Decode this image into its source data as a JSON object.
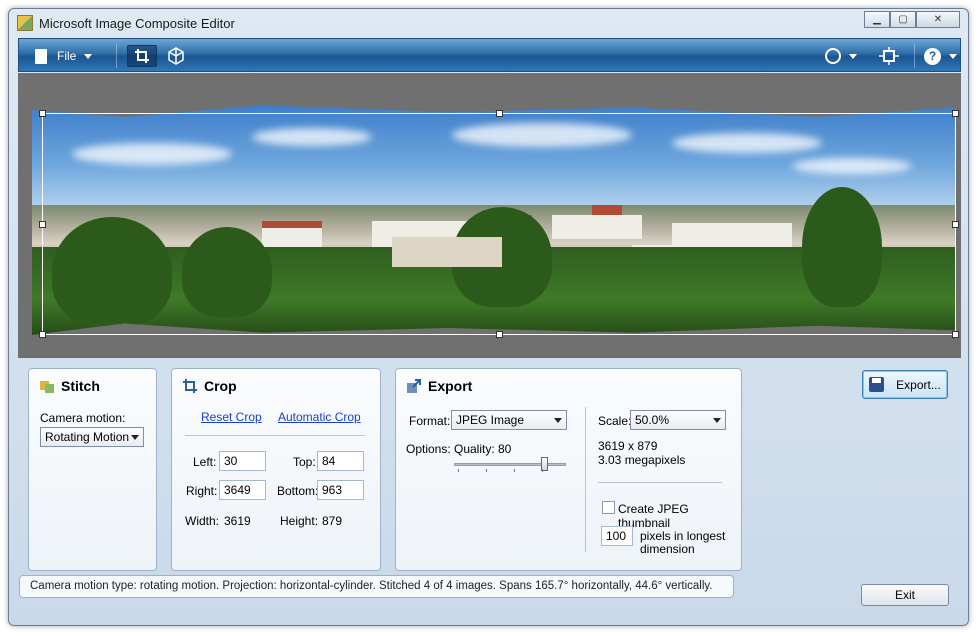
{
  "window": {
    "title": "Microsoft Image Composite Editor"
  },
  "toolbar": {
    "file_label": "File"
  },
  "stitch": {
    "title": "Stitch",
    "camera_motion_label": "Camera motion:",
    "camera_motion_value": "Rotating Motion"
  },
  "crop": {
    "title": "Crop",
    "reset_link": "Reset Crop",
    "auto_link": "Automatic Crop",
    "left_label": "Left:",
    "left_value": "30",
    "top_label": "Top:",
    "top_value": "84",
    "right_label": "Right:",
    "right_value": "3649",
    "bottom_label": "Bottom:",
    "bottom_value": "963",
    "width_label": "Width:",
    "width_value": "3619",
    "height_label": "Height:",
    "height_value": "879"
  },
  "export": {
    "title": "Export",
    "format_label": "Format:",
    "format_value": "JPEG Image",
    "options_label": "Options:",
    "quality_label": "Quality:",
    "quality_value": "80",
    "quality_fraction": 0.8,
    "scale_label": "Scale:",
    "scale_value": "50.0%",
    "dimensions": "3619 x 879",
    "megapixels": "3.03 megapixels",
    "thumbnail_label": "Create JPEG thumbnail",
    "thumbnail_checked": false,
    "pixels_value": "100",
    "pixels_label_1": "pixels in longest",
    "pixels_label_2": "dimension"
  },
  "buttons": {
    "export": "Export...",
    "exit": "Exit"
  },
  "status": "Camera motion type: rotating motion. Projection: horizontal-cylinder. Stitched 4 of 4 images. Spans 165.7° horizontally, 44.6° vertically.",
  "colors": {
    "toolbar_blue": "#2e6ea8",
    "link_blue": "#1a3fd1",
    "canvas_gray": "#707070"
  }
}
